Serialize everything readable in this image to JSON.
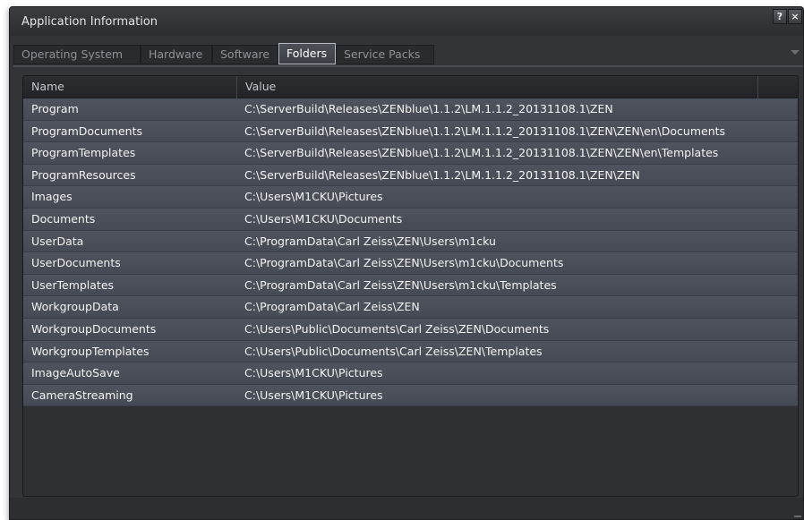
{
  "window": {
    "title": "Application Information",
    "help_label": "?",
    "close_label": "×"
  },
  "tabs": [
    {
      "label": "Operating System"
    },
    {
      "label": "Hardware"
    },
    {
      "label": "Software"
    },
    {
      "label": "Folders",
      "active": true
    },
    {
      "label": "Service Packs"
    }
  ],
  "table": {
    "columns": [
      "Name",
      "Value"
    ],
    "rows": [
      {
        "name": "Program",
        "value": "C:\\ServerBuild\\Releases\\ZENblue\\1.1.2\\LM.1.1.2_20131108.1\\ZEN"
      },
      {
        "name": "ProgramDocuments",
        "value": "C:\\ServerBuild\\Releases\\ZENblue\\1.1.2\\LM.1.1.2_20131108.1\\ZEN\\ZEN\\en\\Documents"
      },
      {
        "name": "ProgramTemplates",
        "value": "C:\\ServerBuild\\Releases\\ZENblue\\1.1.2\\LM.1.1.2_20131108.1\\ZEN\\ZEN\\en\\Templates"
      },
      {
        "name": "ProgramResources",
        "value": "C:\\ServerBuild\\Releases\\ZENblue\\1.1.2\\LM.1.1.2_20131108.1\\ZEN\\ZEN"
      },
      {
        "name": "Images",
        "value": "C:\\Users\\M1CKU\\Pictures"
      },
      {
        "name": "Documents",
        "value": "C:\\Users\\M1CKU\\Documents"
      },
      {
        "name": "UserData",
        "value": "C:\\ProgramData\\Carl Zeiss\\ZEN\\Users\\m1cku"
      },
      {
        "name": "UserDocuments",
        "value": "C:\\ProgramData\\Carl Zeiss\\ZEN\\Users\\m1cku\\Documents"
      },
      {
        "name": "UserTemplates",
        "value": "C:\\ProgramData\\Carl Zeiss\\ZEN\\Users\\m1cku\\Templates"
      },
      {
        "name": "WorkgroupData",
        "value": "C:\\ProgramData\\Carl Zeiss\\ZEN"
      },
      {
        "name": "WorkgroupDocuments",
        "value": "C:\\Users\\Public\\Documents\\Carl Zeiss\\ZEN\\Documents"
      },
      {
        "name": "WorkgroupTemplates",
        "value": "C:\\Users\\Public\\Documents\\Carl Zeiss\\ZEN\\Templates"
      },
      {
        "name": "ImageAutoSave",
        "value": "C:\\Users\\M1CKU\\Pictures"
      },
      {
        "name": "CameraStreaming",
        "value": "C:\\Users\\M1CKU\\Pictures"
      }
    ]
  },
  "colors": {
    "window_bg": "#333437",
    "row_bg": "#4e535e",
    "active_tab_border": "#b9bcc4"
  }
}
